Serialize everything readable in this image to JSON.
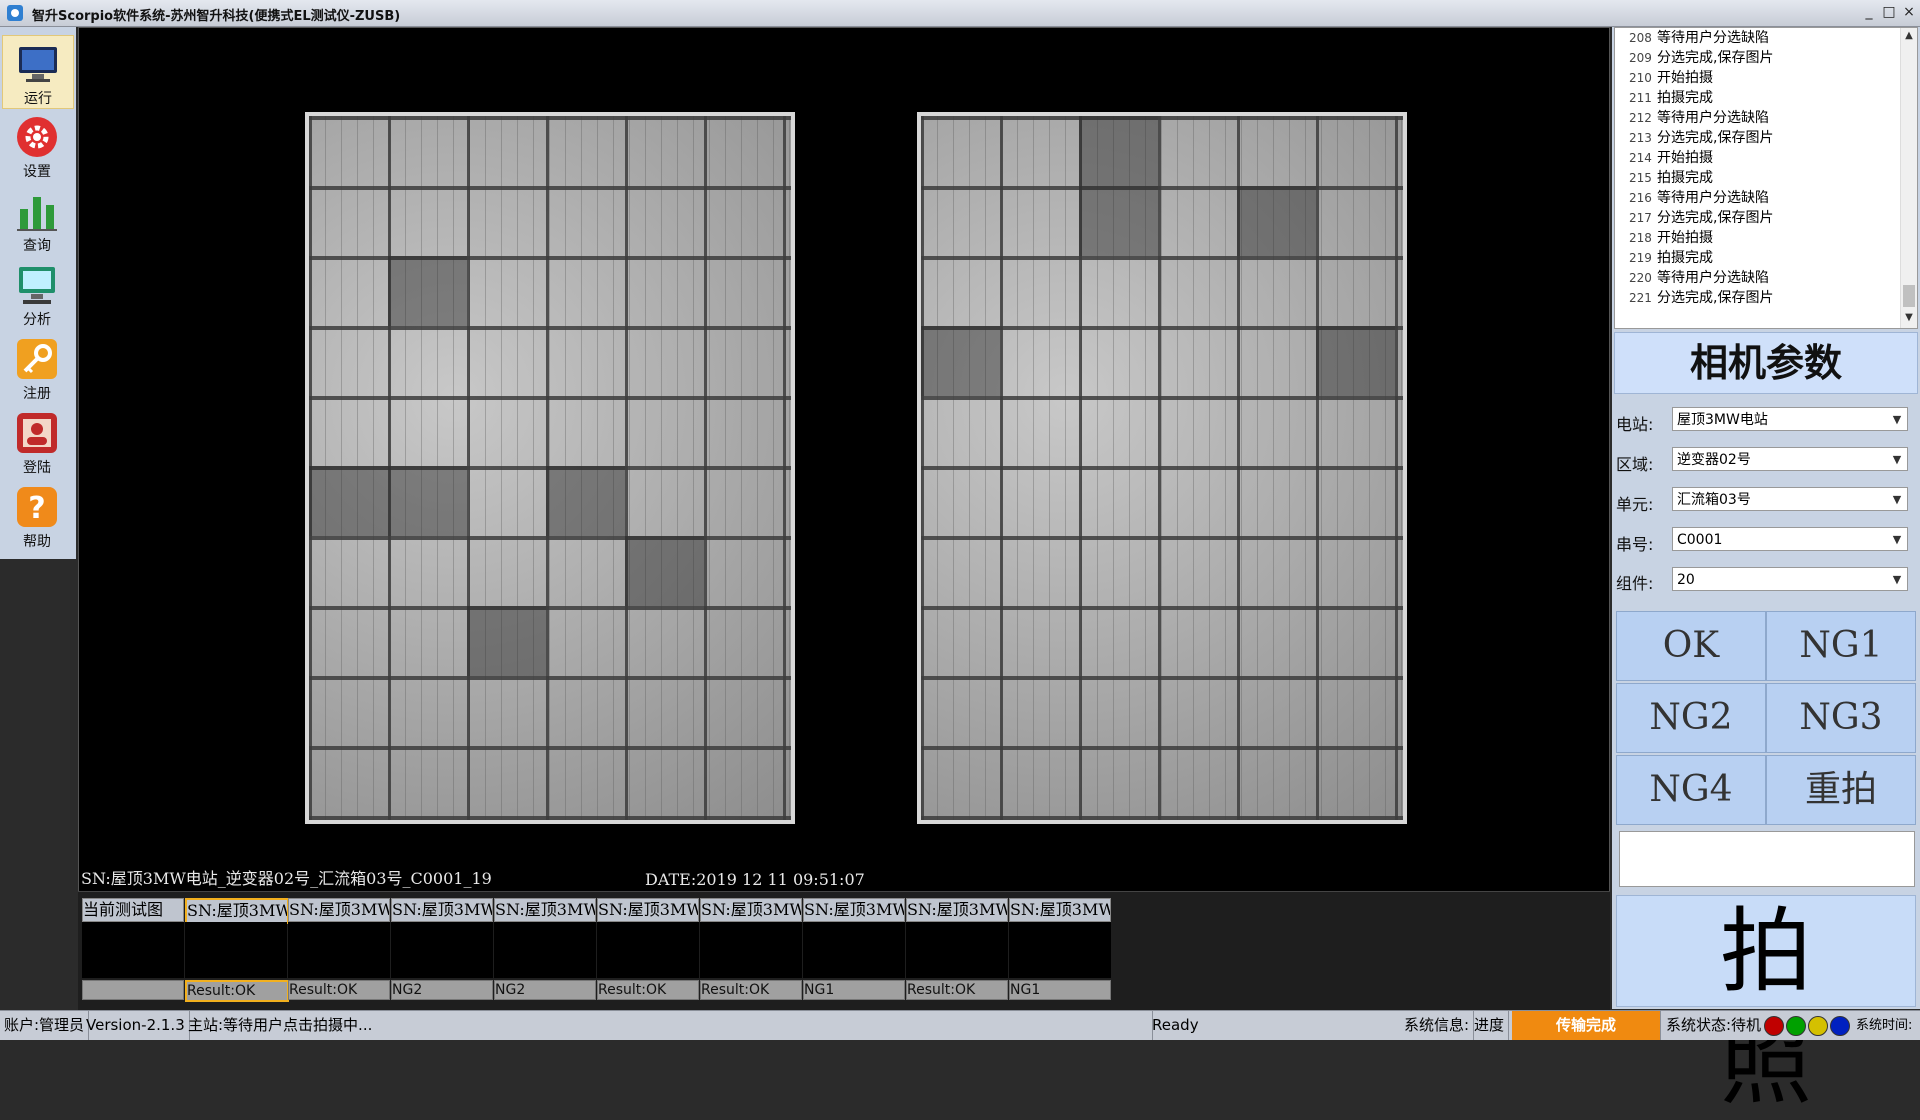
{
  "window": {
    "title": "智升Scorpio软件系统-苏州智升科技(便携式EL测试仪-ZUSB)",
    "controls": [
      "_",
      "□",
      "×"
    ]
  },
  "sidebar": {
    "items": [
      {
        "label": "运行",
        "icon": "monitor-icon",
        "active": true
      },
      {
        "label": "设置",
        "icon": "gear-icon"
      },
      {
        "label": "查询",
        "icon": "bar-chart-icon"
      },
      {
        "label": "分析",
        "icon": "computer-icon"
      },
      {
        "label": "注册",
        "icon": "key-icon"
      },
      {
        "label": "登陆",
        "icon": "user-card-icon"
      },
      {
        "label": "帮助",
        "icon": "help-icon"
      }
    ]
  },
  "viewer": {
    "sn_text": "SN:屋顶3MW电站_逆变器02号_汇流箱03号_C0001_19",
    "date_text": "DATE:2019 12 11 09:51:07"
  },
  "thumbnails": [
    {
      "header": "当前测试图",
      "result": ""
    },
    {
      "header": "SN:屋顶3MW",
      "result": "Result:OK",
      "selected": true
    },
    {
      "header": "SN:屋顶3MW",
      "result": "Result:OK"
    },
    {
      "header": "SN:屋顶3MW",
      "result": "NG2"
    },
    {
      "header": "SN:屋顶3MW",
      "result": "NG2"
    },
    {
      "header": "SN:屋顶3MW",
      "result": "Result:OK"
    },
    {
      "header": "SN:屋顶3MW",
      "result": "Result:OK"
    },
    {
      "header": "SN:屋顶3MW",
      "result": "NG1"
    },
    {
      "header": "SN:屋顶3MW",
      "result": "Result:OK"
    },
    {
      "header": "SN:屋顶3MW",
      "result": "NG1"
    }
  ],
  "log": {
    "lines": [
      {
        "n": "208",
        "text": "等待用户分选缺陷"
      },
      {
        "n": "209",
        "text": "分选完成,保存图片"
      },
      {
        "n": "210",
        "text": "开始拍摄"
      },
      {
        "n": "211",
        "text": "拍摄完成"
      },
      {
        "n": "212",
        "text": "等待用户分选缺陷"
      },
      {
        "n": "213",
        "text": "分选完成,保存图片"
      },
      {
        "n": "214",
        "text": "开始拍摄"
      },
      {
        "n": "215",
        "text": "拍摄完成"
      },
      {
        "n": "216",
        "text": "等待用户分选缺陷"
      },
      {
        "n": "217",
        "text": "分选完成,保存图片"
      },
      {
        "n": "218",
        "text": "开始拍摄"
      },
      {
        "n": "219",
        "text": "拍摄完成"
      },
      {
        "n": "220",
        "text": "等待用户分选缺陷"
      },
      {
        "n": "221",
        "text": "分选完成,保存图片"
      }
    ]
  },
  "camera_params": {
    "title": "相机参数",
    "fields": [
      {
        "label": "电站:",
        "value": "屋顶3MW电站"
      },
      {
        "label": "区域:",
        "value": "逆变器02号"
      },
      {
        "label": "单元:",
        "value": "汇流箱03号"
      },
      {
        "label": "串号:",
        "value": "C0001"
      },
      {
        "label": "组件:",
        "value": "20"
      }
    ]
  },
  "grade_buttons": [
    "OK",
    "NG1",
    "NG2",
    "NG3",
    "NG4",
    "重拍"
  ],
  "shoot_button": "拍照",
  "statusbar": {
    "account": "账户:管理员",
    "version": "Version-2.1.3",
    "main": "主站:等待用户点击拍摄中...",
    "ready": "Ready",
    "sysinfo": "系统信息:",
    "progress_label": "进度",
    "transfer": "传输完成",
    "sys_state": "系统状态:待机",
    "sys_time": "系统时间:",
    "led_colors": [
      "#c00000",
      "#00a000",
      "#d4c000",
      "#0020c0"
    ]
  }
}
